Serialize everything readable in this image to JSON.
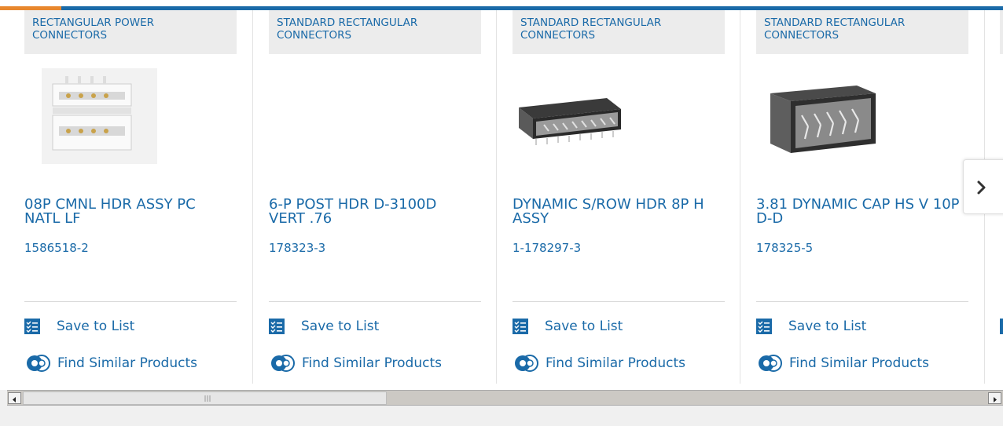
{
  "products": [
    {
      "category": "RECTANGULAR POWER CONNECTORS",
      "title": "08P CMNL HDR ASSY PC NATL LF",
      "part_number": "1586518-2",
      "save_label": "Save to List",
      "similar_label": "Find Similar Products",
      "image": "white-power-header-connector"
    },
    {
      "category": "STANDARD RECTANGULAR CONNECTORS",
      "title": "6-P POST HDR D-3100D VERT .76",
      "part_number": "178323-3",
      "save_label": "Save to List",
      "similar_label": "Find Similar Products",
      "image": "none"
    },
    {
      "category": "STANDARD RECTANGULAR CONNECTORS",
      "title": "DYNAMIC S/ROW HDR 8P H ASSY",
      "part_number": "1-178297-3",
      "save_label": "Save to List",
      "similar_label": "Find Similar Products",
      "image": "black-horizontal-header"
    },
    {
      "category": "STANDARD RECTANGULAR CONNECTORS",
      "title": "3.81 DYNAMIC CAP HS V 10P D-D",
      "part_number": "178325-5",
      "save_label": "Save to List",
      "similar_label": "Find Similar Products",
      "image": "black-vertical-cap-header"
    }
  ],
  "navigation": {
    "next_icon": "chevron-right-icon"
  },
  "colors": {
    "brand_blue": "#1a6aa8",
    "accent_orange": "#e8872d",
    "category_bg": "#ececec"
  }
}
